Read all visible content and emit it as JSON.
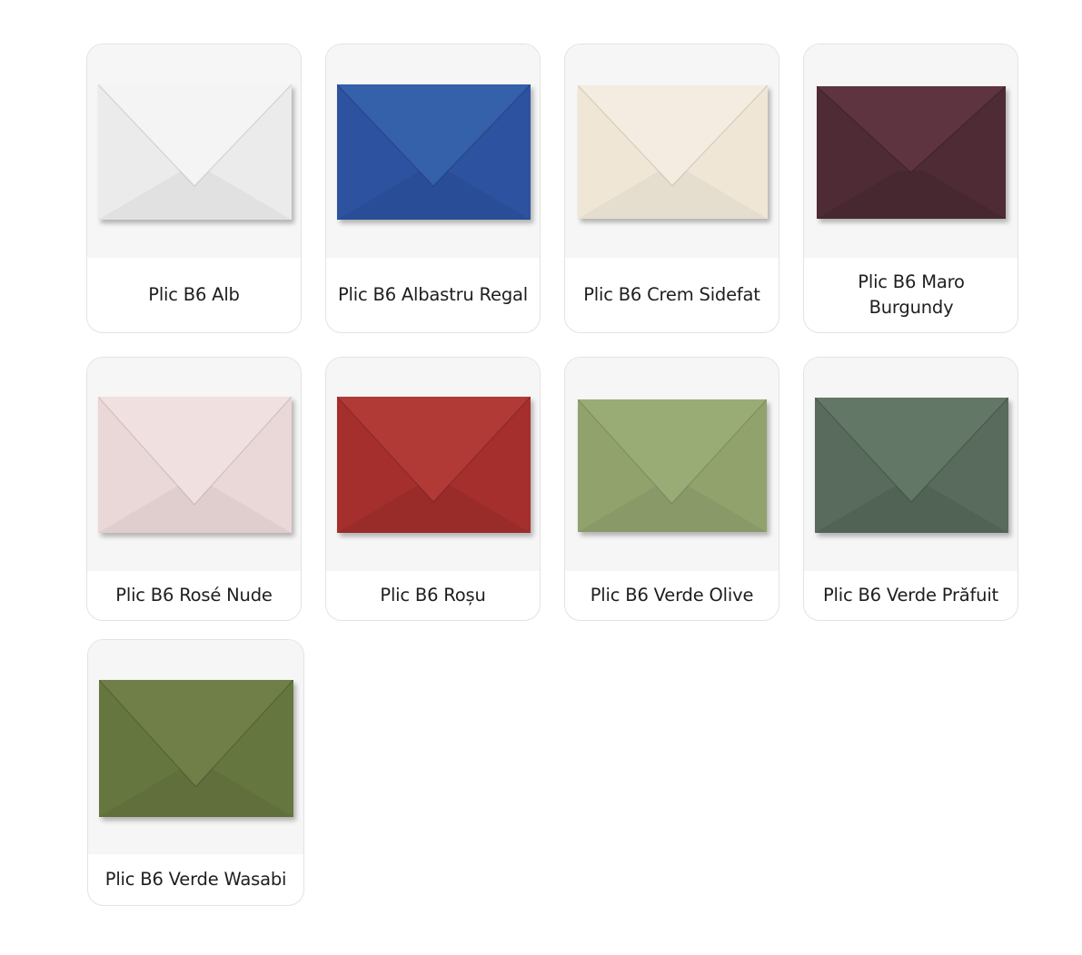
{
  "products": [
    {
      "label": "Plic B6 Alb",
      "color": "#ebebeb",
      "flap_color": "#f4f4f4"
    },
    {
      "label": "Plic B6 Albastru Regal",
      "color": "#2c52a0",
      "flap_color": "#3560aa"
    },
    {
      "label": "Plic B6 Crem Sidefat",
      "color": "#efe6d6",
      "flap_color": "#f4ece0"
    },
    {
      "label": "Plic B6 Maro Burgundy",
      "color": "#4e2b35",
      "flap_color": "#5d3440"
    },
    {
      "label": "Plic B6 Rosé Nude",
      "color": "#ead7d7",
      "flap_color": "#f1e0e0"
    },
    {
      "label": "Plic B6 Roșu",
      "color": "#a52f2d",
      "flap_color": "#b23a36"
    },
    {
      "label": "Plic B6 Verde Olive",
      "color": "#91a26d",
      "flap_color": "#9aac76"
    },
    {
      "label": "Plic B6 Verde Prăfuit",
      "color": "#586b5c",
      "flap_color": "#627766"
    },
    {
      "label": "Plic B6 Verde Wasabi",
      "color": "#66763f",
      "flap_color": "#6f7f47"
    }
  ]
}
